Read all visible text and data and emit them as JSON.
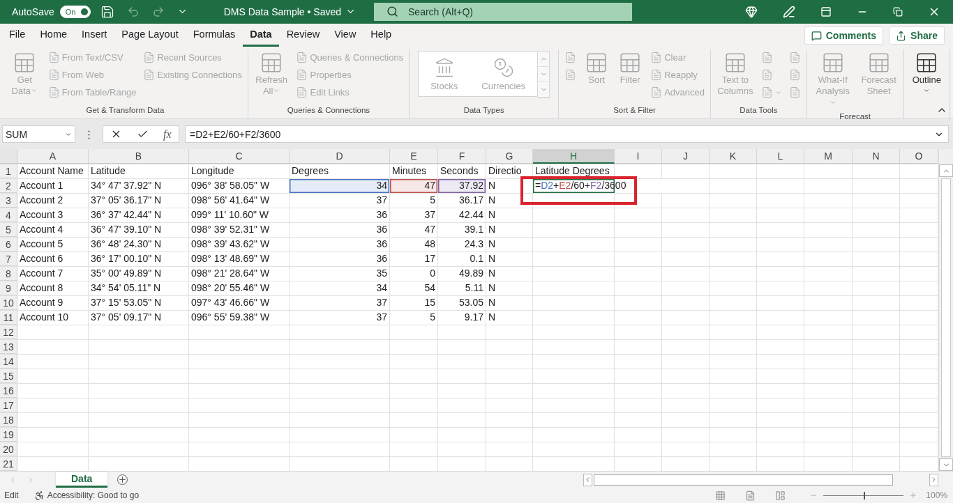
{
  "title_bar": {
    "autosave_label": "AutoSave",
    "autosave": {
      "label": "On",
      "on": true
    },
    "title": "DMS Data Sample • Saved",
    "search": {
      "placeholder": "Search (Alt+Q)"
    }
  },
  "menu_tabs": [
    {
      "label": "File",
      "selected": false
    },
    {
      "label": "Home",
      "selected": false
    },
    {
      "label": "Insert",
      "selected": false
    },
    {
      "label": "Page Layout",
      "selected": false
    },
    {
      "label": "Formulas",
      "selected": false
    },
    {
      "label": "Data",
      "selected": true
    },
    {
      "label": "Review",
      "selected": false
    },
    {
      "label": "View",
      "selected": false
    },
    {
      "label": "Help",
      "selected": false
    }
  ],
  "actions": [
    {
      "label": "Comments"
    },
    {
      "label": "Share"
    }
  ],
  "ribbon": {
    "groups": [
      {
        "label": "Get & Transform Data",
        "columns": [
          {
            "kind": "large",
            "label": "Get Data",
            "dropdown": true,
            "disabled": true
          },
          {
            "kind": "stack",
            "items": [
              {
                "label": "From Text/CSV",
                "disabled": true
              },
              {
                "label": "From Web",
                "disabled": true
              },
              {
                "label": "From Table/Range",
                "disabled": true
              }
            ]
          },
          {
            "kind": "stack",
            "items": [
              {
                "label": "Recent Sources",
                "disabled": true
              },
              {
                "label": "Existing Connections",
                "disabled": true
              }
            ]
          }
        ]
      },
      {
        "label": "Queries & Connections",
        "columns": [
          {
            "kind": "large",
            "label": "Refresh All",
            "dropdown": true,
            "disabled": true
          },
          {
            "kind": "stack",
            "items": [
              {
                "label": "Queries & Connections",
                "disabled": true
              },
              {
                "label": "Properties",
                "disabled": true
              },
              {
                "label": "Edit Links",
                "disabled": true
              }
            ]
          }
        ]
      },
      {
        "label": "Data Types",
        "columns": [
          {
            "kind": "gallery",
            "items": [
              {
                "label": "Stocks",
                "disabled": true
              },
              {
                "label": "Currencies",
                "disabled": true
              }
            ]
          }
        ]
      },
      {
        "label": "Sort & Filter",
        "columns": [
          {
            "kind": "stack",
            "items": [
              {
                "disabled": true
              },
              {
                "disabled": true
              }
            ]
          },
          {
            "kind": "large",
            "label": "Sort",
            "disabled": true
          },
          {
            "kind": "large",
            "label": "Filter",
            "disabled": true
          },
          {
            "kind": "stack",
            "items": [
              {
                "label": "Clear",
                "disabled": true
              },
              {
                "label": "Reapply",
                "disabled": true
              },
              {
                "label": "Advanced",
                "disabled": true
              }
            ]
          }
        ]
      },
      {
        "label": "Data Tools",
        "columns": [
          {
            "kind": "large",
            "label": "Text to Columns",
            "disabled": true
          },
          {
            "kind": "stack",
            "items": [
              {
                "disabled": true
              },
              {
                "disabled": true
              },
              {
                "disabled": true,
                "dropdown": true
              }
            ]
          },
          {
            "kind": "stack",
            "items": [
              {
                "disabled": true
              },
              {
                "disabled": true
              },
              {
                "disabled": true
              }
            ]
          }
        ]
      },
      {
        "label": "Forecast",
        "columns": [
          {
            "kind": "large",
            "label": "What-If Analysis",
            "dropdown": true,
            "disabled": true
          },
          {
            "kind": "large",
            "label": "Forecast Sheet",
            "disabled": true
          }
        ]
      },
      {
        "columns": [
          {
            "kind": "large",
            "label": "Outline",
            "dropdown": true,
            "disabled": false
          }
        ]
      }
    ]
  },
  "formula_bar": {
    "name_box": "SUM",
    "fx_label": "fx",
    "formula": "=D2+E2/60+F2/3600"
  },
  "sheet": {
    "columns": [
      {
        "letter": "A",
        "selected": false
      },
      {
        "letter": "B",
        "selected": false
      },
      {
        "letter": "C",
        "selected": false
      },
      {
        "letter": "D",
        "selected": false
      },
      {
        "letter": "E",
        "selected": false
      },
      {
        "letter": "F",
        "selected": false
      },
      {
        "letter": "G",
        "selected": false
      },
      {
        "letter": "H",
        "selected": true
      },
      {
        "letter": "I",
        "selected": false
      },
      {
        "letter": "J",
        "selected": false
      },
      {
        "letter": "K",
        "selected": false
      },
      {
        "letter": "L",
        "selected": false
      },
      {
        "letter": "M",
        "selected": false
      },
      {
        "letter": "N",
        "selected": false
      },
      {
        "letter": "O",
        "selected": false
      }
    ],
    "rows": [
      {
        "number": "1",
        "cells": [
          "Account Name",
          "Latitude",
          "Longitude",
          "Degrees",
          "Minutes",
          "Seconds",
          "Directio",
          "Latitude Degrees"
        ]
      },
      {
        "number": "2",
        "cells": [
          "Account 1",
          "34° 47' 37.92\" N",
          "096° 38' 58.05\" W",
          {
            "text": "34",
            "color": "#4472c4"
          },
          {
            "text": "47",
            "color": "#c0504d"
          },
          {
            "text": "37.92",
            "color": "#8064a2"
          },
          "N",
          {
            "editing": true,
            "segments": [
              {
                "text": "="
              },
              {
                "text": "D2",
                "color": "#4472c4"
              },
              {
                "text": "+"
              },
              {
                "text": "E2",
                "color": "#c0504d"
              },
              {
                "text": "/60+"
              },
              {
                "text": "F2",
                "color": "#8064a2"
              },
              {
                "text": "/3600"
              }
            ]
          }
        ]
      },
      {
        "number": "3",
        "cells": [
          "Account 2",
          "37° 05' 36.17\" N",
          "098° 56' 41.64\" W",
          "37",
          "5",
          "36.17",
          "N"
        ]
      },
      {
        "number": "4",
        "cells": [
          "Account 3",
          "36° 37' 42.44\" N",
          "099° 11' 10.60\" W",
          "36",
          "37",
          "42.44",
          "N"
        ]
      },
      {
        "number": "5",
        "cells": [
          "Account 4",
          "36° 47' 39.10\" N",
          "098° 39' 52.31\" W",
          "36",
          "47",
          "39.1",
          "N"
        ]
      },
      {
        "number": "6",
        "cells": [
          "Account 5",
          "36° 48' 24.30\" N",
          "098° 39' 43.62\" W",
          "36",
          "48",
          "24.3",
          "N"
        ]
      },
      {
        "number": "7",
        "cells": [
          "Account 6",
          "36° 17' 00.10\" N",
          "098° 13' 48.69\" W",
          "36",
          "17",
          "0.1",
          "N"
        ]
      },
      {
        "number": "8",
        "cells": [
          "Account 7",
          "35° 00' 49.89\" N",
          "098° 21' 28.64\" W",
          "35",
          "0",
          "49.89",
          "N"
        ]
      },
      {
        "number": "9",
        "cells": [
          "Account 8",
          "34° 54' 05.11\" N",
          "098° 20' 55.46\" W",
          "34",
          "54",
          "5.11",
          "N"
        ]
      },
      {
        "number": "10",
        "cells": [
          "Account 9",
          "37° 15' 53.05\" N",
          "097° 43' 46.66\" W",
          "37",
          "15",
          "53.05",
          "N"
        ]
      },
      {
        "number": "11",
        "cells": [
          "Account 10",
          "37° 05' 09.17\" N",
          "096° 55' 59.38\" W",
          "37",
          "5",
          "9.17",
          "N"
        ]
      },
      {
        "number": "12",
        "cells": []
      },
      {
        "number": "13",
        "cells": []
      },
      {
        "number": "14",
        "cells": []
      },
      {
        "number": "15",
        "cells": []
      },
      {
        "number": "16",
        "cells": []
      },
      {
        "number": "17",
        "cells": []
      },
      {
        "number": "18",
        "cells": []
      },
      {
        "number": "19",
        "cells": []
      },
      {
        "number": "20",
        "cells": []
      },
      {
        "number": "21",
        "cells": []
      }
    ],
    "annotation": {
      "color": "#d9232e"
    }
  },
  "sheet_tabs": [
    {
      "label": "Data",
      "selected": true
    }
  ],
  "status_bar": {
    "mode": "Edit",
    "accessibility": "Accessibility: Good to go",
    "zoom": {
      "level": 0.5,
      "reading": "100%"
    }
  }
}
